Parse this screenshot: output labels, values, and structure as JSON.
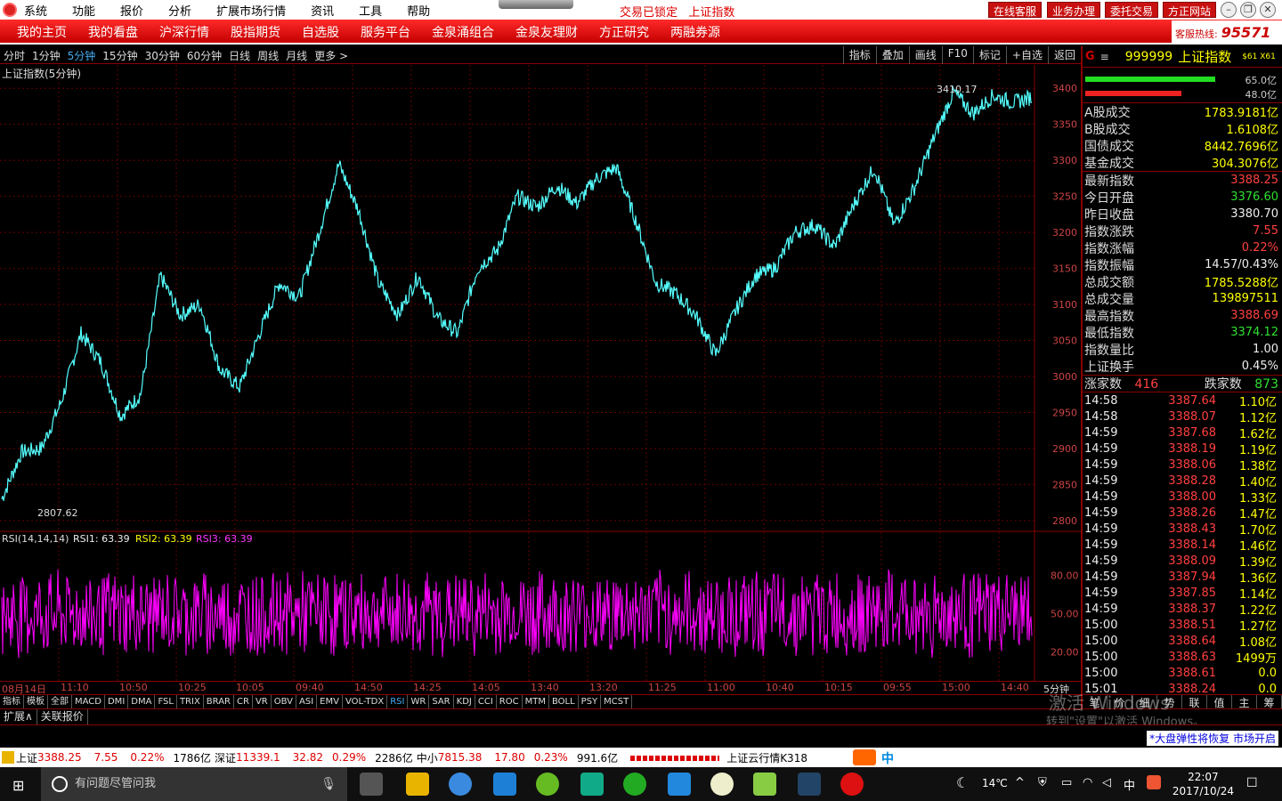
{
  "menu": {
    "items": [
      "系统",
      "功能",
      "报价",
      "分析",
      "扩展市场行情",
      "资讯",
      "工具",
      "帮助"
    ]
  },
  "status": {
    "lock": "交易已锁定",
    "index": "上证指数"
  },
  "top_buttons": [
    "在线客服",
    "业务办理",
    "委托交易",
    "方正网站"
  ],
  "nav": {
    "items": [
      "我的主页",
      "我的看盘",
      "沪深行情",
      "股指期货",
      "自选股",
      "服务平台",
      "金泉涌组合",
      "金泉友理财",
      "方正研究",
      "两融券源"
    ]
  },
  "hotline": {
    "label": "客服热线:",
    "number": "95571"
  },
  "periods": {
    "items": [
      "分时",
      "1分钟",
      "5分钟",
      "15分钟",
      "30分钟",
      "60分钟",
      "日线",
      "周线",
      "月线",
      "更多 >"
    ],
    "active": "5分钟"
  },
  "tools": {
    "items": [
      "指标",
      "叠加",
      "画线",
      "F10",
      "标记",
      "+自选",
      "返回"
    ]
  },
  "chart": {
    "title": "上证指数(5分钟)",
    "high_label": "3410.17",
    "low_label": "2807.62",
    "y_ticks": [
      "3400",
      "3350",
      "3300",
      "3250",
      "3200",
      "3150",
      "3100",
      "3050",
      "3000",
      "2950",
      "2900",
      "2850",
      "2800"
    ],
    "rsi_label": "RSI(14,14,14)",
    "rsi1": "RSI1: 63.39",
    "rsi2": "RSI2: 63.39",
    "rsi3": "RSI3: 63.39",
    "rsi_ticks": [
      "80.00",
      "50.00",
      "20.00"
    ],
    "x_labels": [
      "08月14日",
      "11:10",
      "10:50",
      "10:25",
      "10:05",
      "09:40",
      "14:50",
      "14:25",
      "14:05",
      "13:40",
      "13:20",
      "11:25",
      "11:00",
      "10:40",
      "10:15",
      "09:55",
      "15:00",
      "14:40"
    ],
    "period_tag": "5分钟"
  },
  "chart_data": [
    {
      "type": "line",
      "title": "上证指数(5分钟)",
      "y_ticks": [
        3400,
        3350,
        3300,
        3250,
        3200,
        3150,
        3100,
        3050,
        3000,
        2950,
        2900,
        2850,
        2800
      ],
      "ylim": [
        2790,
        3420
      ],
      "x_labels": [
        "08月14日",
        "11:10",
        "10:50",
        "10:25",
        "10:05",
        "09:40",
        "14:50",
        "14:25",
        "14:05",
        "13:40",
        "13:20",
        "11:25",
        "11:00",
        "10:40",
        "10:15",
        "09:55",
        "15:00",
        "14:40"
      ],
      "series": [
        {
          "values": [
            2830,
            2895,
            2900,
            2965,
            3060,
            3020,
            2945,
            2975,
            3140,
            3085,
            3100,
            3010,
            2985,
            3060,
            3130,
            3110,
            3200,
            3295,
            3230,
            3130,
            3085,
            3140,
            3080,
            3060,
            3150,
            3175,
            3250,
            3235,
            3265,
            3240,
            3275,
            3290,
            3215,
            3130,
            3115,
            3085,
            3030,
            3090,
            3140,
            3150,
            3200,
            3210,
            3180,
            3240,
            3290,
            3210,
            3260,
            3330,
            3395,
            3365,
            3390,
            3380,
            3388
          ]
        }
      ],
      "annotations": [
        "3410.17",
        "2807.62"
      ]
    },
    {
      "type": "line",
      "title": "RSI(14,14,14)",
      "y_ticks": [
        80,
        50,
        20
      ],
      "ylim": [
        0,
        100
      ],
      "series": [
        {
          "name": "RSI1",
          "values": [
            63.39
          ]
        },
        {
          "name": "RSI2",
          "values": [
            63.39
          ]
        },
        {
          "name": "RSI3",
          "values": [
            63.39
          ]
        }
      ]
    }
  ],
  "indicators": {
    "items": [
      "指标",
      "模板",
      "全部",
      "MACD",
      "DMI",
      "DMA",
      "FSL",
      "TRIX",
      "BRAR",
      "CR",
      "VR",
      "OBV",
      "ASI",
      "EMV",
      "VOL-TDX",
      "RSI",
      "WR",
      "SAR",
      "KDJ",
      "CCI",
      "ROC",
      "MTM",
      "BOLL",
      "PSY",
      "MCST"
    ],
    "active": "RSI"
  },
  "subtabs": {
    "items": [
      "扩展∧",
      "关联报价"
    ]
  },
  "panel": {
    "code": "999999",
    "name": "上证指数",
    "tag": "$61 X61",
    "bar1": "65.0亿",
    "bar2": "48.0亿",
    "stats": [
      {
        "label": "A股成交",
        "value": "1783.9181亿",
        "color": "yel"
      },
      {
        "label": "B股成交",
        "value": "1.6108亿",
        "color": "yel"
      },
      {
        "label": "国债成交",
        "value": "8442.7696亿",
        "color": "yel"
      },
      {
        "label": "基金成交",
        "value": "304.3076亿",
        "color": "yel"
      }
    ],
    "quote": [
      {
        "label": "最新指数",
        "value": "3388.25",
        "color": "red"
      },
      {
        "label": "今日开盘",
        "value": "3376.60",
        "color": "green"
      },
      {
        "label": "昨日收盘",
        "value": "3380.70",
        "color": "wht"
      },
      {
        "label": "指数涨跌",
        "value": "7.55",
        "color": "red"
      },
      {
        "label": "指数涨幅",
        "value": "0.22%",
        "color": "red"
      },
      {
        "label": "指数振幅",
        "value": "14.57/0.43%",
        "color": "wht"
      },
      {
        "label": "总成交额",
        "value": "1785.5288亿",
        "color": "yel"
      },
      {
        "label": "总成交量",
        "value": "139897511",
        "color": "yel"
      },
      {
        "label": "最高指数",
        "value": "3388.69",
        "color": "red"
      },
      {
        "label": "最低指数",
        "value": "3374.12",
        "color": "green"
      },
      {
        "label": "指数量比",
        "value": "1.00",
        "color": "wht"
      },
      {
        "label": "上证换手",
        "value": "0.45%",
        "color": "wht"
      }
    ],
    "updown": {
      "up_label": "涨家数",
      "up": "416",
      "down_label": "跌家数",
      "down": "873"
    },
    "ticks": [
      {
        "t": "14:58",
        "p": "3387.64",
        "v": "1.10亿"
      },
      {
        "t": "14:58",
        "p": "3388.07",
        "v": "1.12亿"
      },
      {
        "t": "14:59",
        "p": "3387.68",
        "v": "1.62亿"
      },
      {
        "t": "14:59",
        "p": "3388.19",
        "v": "1.19亿"
      },
      {
        "t": "14:59",
        "p": "3388.06",
        "v": "1.38亿"
      },
      {
        "t": "14:59",
        "p": "3388.28",
        "v": "1.40亿"
      },
      {
        "t": "14:59",
        "p": "3388.00",
        "v": "1.33亿"
      },
      {
        "t": "14:59",
        "p": "3388.26",
        "v": "1.47亿"
      },
      {
        "t": "14:59",
        "p": "3388.43",
        "v": "1.70亿"
      },
      {
        "t": "14:59",
        "p": "3388.14",
        "v": "1.46亿"
      },
      {
        "t": "14:59",
        "p": "3388.09",
        "v": "1.39亿"
      },
      {
        "t": "14:59",
        "p": "3387.94",
        "v": "1.36亿"
      },
      {
        "t": "14:59",
        "p": "3387.85",
        "v": "1.14亿"
      },
      {
        "t": "14:59",
        "p": "3388.37",
        "v": "1.22亿"
      },
      {
        "t": "15:00",
        "p": "3388.51",
        "v": "1.27亿"
      },
      {
        "t": "15:00",
        "p": "3388.64",
        "v": "1.08亿"
      },
      {
        "t": "15:00",
        "p": "3388.63",
        "v": "1499万"
      },
      {
        "t": "15:00",
        "p": "3388.61",
        "v": "0.0"
      },
      {
        "t": "15:01",
        "p": "3388.24",
        "v": "0.0"
      }
    ],
    "bottom_tabs": [
      "笔",
      "价",
      "细",
      "势",
      "联",
      "值",
      "主",
      "筹"
    ]
  },
  "statusbar": {
    "news": "*大盘弹性将恢复 市场开启"
  },
  "indexbar": {
    "sh_label": "上证",
    "sh_value": "3388.25",
    "sh_chg": "7.55",
    "sh_pct": "0.22%",
    "sh_amt": "1786亿",
    "sz_label": "深证",
    "sz_value": "11339.1",
    "sz_chg": "32.82",
    "sz_pct": "0.29%",
    "sz_amt": "2286亿",
    "zx_label": "中小",
    "zx_value": "7815.38",
    "zx_chg": "17.80",
    "zx_pct": "0.23%",
    "zx_amt": "991.6亿",
    "cloud": "上证云行情K318"
  },
  "ime": {
    "label": "中"
  },
  "watermark": {
    "line1": "激活 Windows",
    "line2": "转到\"设置\"以激活 Windows。"
  },
  "taskbar": {
    "search": "有问题尽管问我",
    "temp": "14℃",
    "ime": "中",
    "time": "22:07",
    "date": "2017/10/24"
  }
}
